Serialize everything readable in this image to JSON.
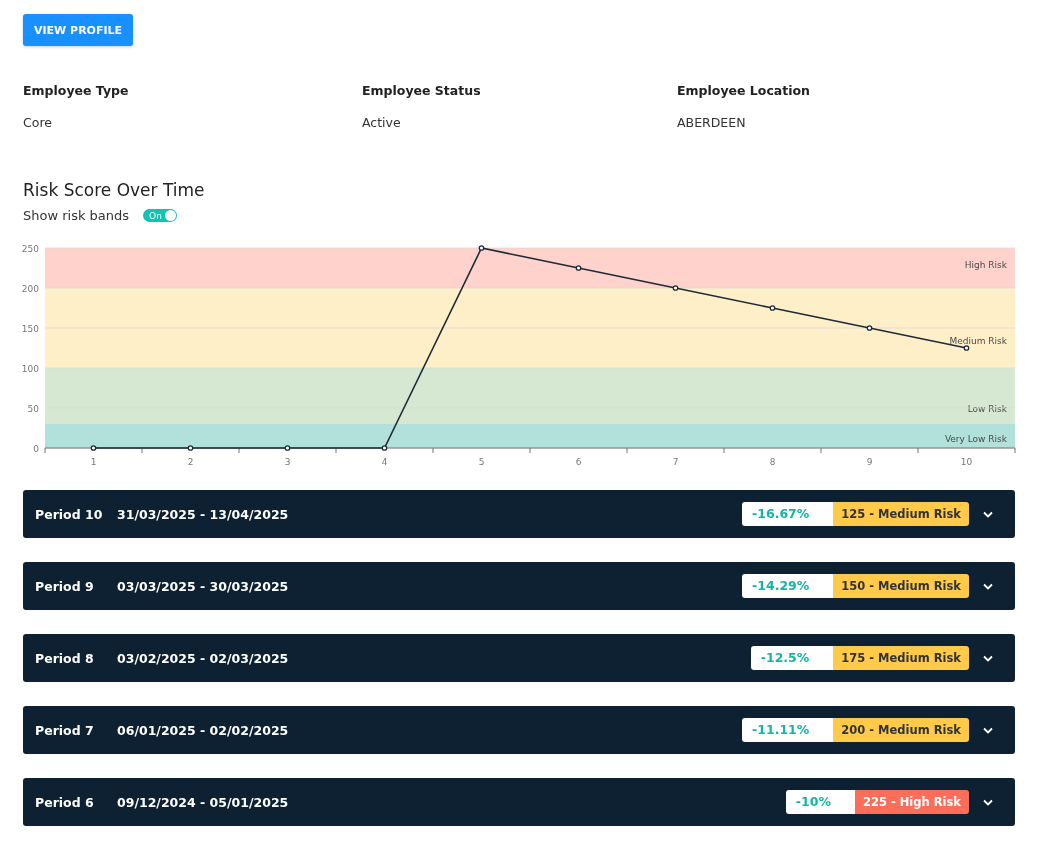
{
  "profile_button": {
    "label": "VIEW PROFILE"
  },
  "details": [
    {
      "label": "Employee Type",
      "value": "Core"
    },
    {
      "label": "Employee Status",
      "value": "Active"
    },
    {
      "label": "Employee Location",
      "value": "ABERDEEN"
    }
  ],
  "risk_section": {
    "title": "Risk Score Over Time",
    "toggle": {
      "label": "Show risk bands",
      "on": true,
      "text": "On"
    },
    "chart_data": {
      "type": "line",
      "categories": [
        "1",
        "2",
        "3",
        "4",
        "5",
        "6",
        "7",
        "8",
        "9",
        "10"
      ],
      "series": [
        {
          "color": "#1e2b38",
          "marker": "circle",
          "values": [
            0,
            0,
            0,
            0,
            250,
            225,
            200,
            175,
            150,
            125
          ]
        }
      ],
      "ylim": [
        0,
        250
      ],
      "yticks": [
        0,
        50,
        100,
        150,
        200,
        250
      ],
      "grid": true,
      "bands": [
        {
          "axis": "y",
          "from": 200,
          "to": 250,
          "label": "High Risk",
          "color": "#ffd2cc"
        },
        {
          "axis": "y",
          "from": 100,
          "to": 200,
          "label": "Medium Risk",
          "color": "#ffefc8"
        },
        {
          "axis": "y",
          "from": 30,
          "to": 100,
          "label": "Low Risk",
          "color": "#d7e8d2"
        },
        {
          "axis": "y",
          "from": 0,
          "to": 30,
          "label": "Very Low Risk",
          "color": "#b2e1dc"
        }
      ]
    }
  },
  "periods": [
    {
      "title": "Period 10",
      "dates": "31/03/2025 - 13/04/2025",
      "change": "-16.67%",
      "score": "125 - Medium Risk",
      "color": "#ffc94a"
    },
    {
      "title": "Period 9",
      "dates": "03/03/2025 - 30/03/2025",
      "change": "-14.29%",
      "score": "150 - Medium Risk",
      "color": "#ffc94a"
    },
    {
      "title": "Period 8",
      "dates": "03/02/2025 - 02/03/2025",
      "change": "-12.5%",
      "score": "175 - Medium Risk",
      "color": "#ffc94a"
    },
    {
      "title": "Period 7",
      "dates": "06/01/2025 - 02/02/2025",
      "change": "-11.11%",
      "score": "200 - Medium Risk",
      "color": "#ffc94a"
    },
    {
      "title": "Period 6",
      "dates": "09/12/2024 - 05/01/2025",
      "change": "-10%",
      "score": "225 - High Risk",
      "color": "#fc6e5a"
    }
  ]
}
